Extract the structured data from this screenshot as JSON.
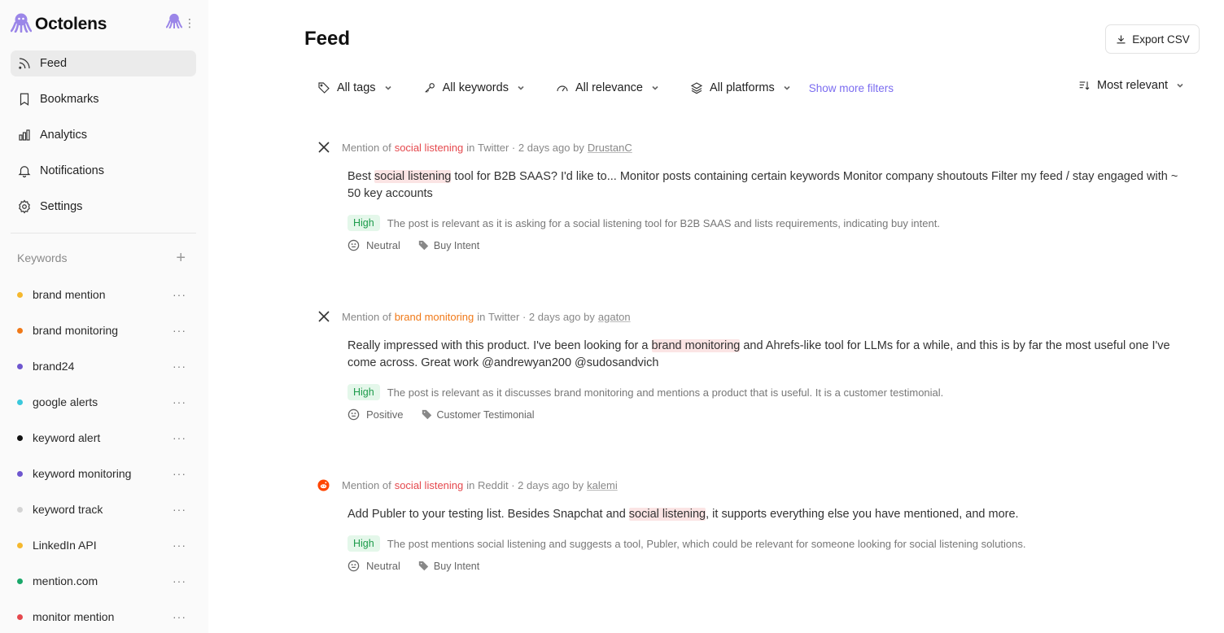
{
  "app": {
    "name": "Octolens"
  },
  "nav": [
    {
      "label": "Feed",
      "icon": "rss-icon",
      "active": true
    },
    {
      "label": "Bookmarks",
      "icon": "bookmark-icon"
    },
    {
      "label": "Analytics",
      "icon": "bar-chart-icon"
    },
    {
      "label": "Notifications",
      "icon": "bell-icon"
    },
    {
      "label": "Settings",
      "icon": "gear-icon"
    }
  ],
  "keywords": {
    "title": "Keywords",
    "add_icon": "plus-icon",
    "items": [
      {
        "name": "brand mention",
        "color": "#f5b82e"
      },
      {
        "name": "brand monitoring",
        "color": "#f07918"
      },
      {
        "name": "brand24",
        "color": "#6e56cf"
      },
      {
        "name": "google alerts",
        "color": "#3ac8dc"
      },
      {
        "name": "keyword alert",
        "color": "#111111"
      },
      {
        "name": "keyword monitoring",
        "color": "#6e56cf"
      },
      {
        "name": "keyword track",
        "color": "#d4d4d4"
      },
      {
        "name": "LinkedIn API",
        "color": "#f5b82e"
      },
      {
        "name": "mention.com",
        "color": "#1aa86a"
      },
      {
        "name": "monitor mention",
        "color": "#e5484d"
      }
    ],
    "more_icon": "ellipsis-icon"
  },
  "header": {
    "title": "Feed",
    "export_label": "Export CSV"
  },
  "filters": {
    "tags": "All tags",
    "keywords": "All keywords",
    "relevance": "All relevance",
    "platforms": "All platforms",
    "more": "Show more filters",
    "sort": "Most relevant"
  },
  "posts": [
    {
      "platform": "Twitter",
      "keyword": "social listening",
      "time": "2 days ago",
      "author": "DrustanC",
      "text_before": "Best ",
      "text_highlight": "social listening",
      "text_after": " tool for B2B SAAS? I'd like to... Monitor posts containing certain keywords Monitor company shoutouts Filter my feed / stay engaged with ~ 50 key accounts",
      "relevance": "High",
      "reason": "The post is relevant as it is asking for a social listening tool for B2B SAAS and lists requirements, indicating buy intent.",
      "sentiment": "Neutral",
      "tag": "Buy Intent"
    },
    {
      "platform": "Twitter",
      "keyword": "brand monitoring",
      "time": "2 days ago",
      "author": "agaton",
      "text_before": "Really impressed with this product. I've been looking for a ",
      "text_highlight": "brand monitoring",
      "text_after": " and Ahrefs-like tool for LLMs for a while, and this is by far the most useful one I've come across. Great work @andrewyan200 @sudosandvich",
      "relevance": "High",
      "reason": "The post is relevant as it discusses brand monitoring and mentions a product that is useful. It is a customer testimonial.",
      "sentiment": "Positive",
      "tag": "Customer Testimonial"
    },
    {
      "platform": "Reddit",
      "keyword": "social listening",
      "time": "2 days ago",
      "author": "kalemi",
      "text_before": "Add Publer to your testing list. Besides Snapchat and ",
      "text_highlight": "social listening",
      "text_after": ", it supports everything else you have mentioned, and more.",
      "relevance": "High",
      "reason": "The post mentions social listening and suggests a tool, Publer, which could be relevant for someone looking for social listening solutions.",
      "sentiment": "Neutral",
      "tag": "Buy Intent"
    }
  ],
  "labels": {
    "mention_of": "Mention of",
    "in": "in",
    "by": "by",
    "sep": "·"
  }
}
